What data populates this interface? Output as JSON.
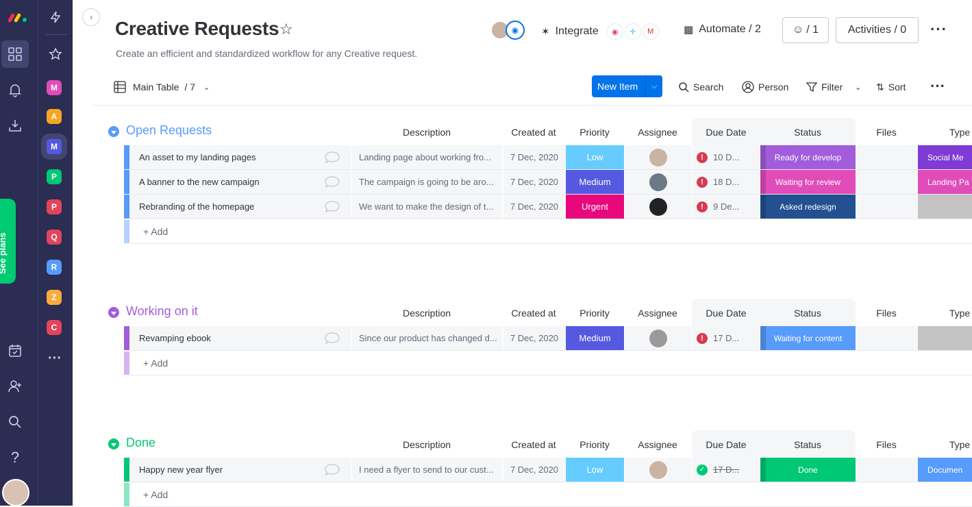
{
  "nav": {
    "logo_colors": [
      "#f62b54",
      "#ffcc00",
      "#00ca72"
    ],
    "see_plans_label": "See plans",
    "workspaces": [
      {
        "letter": "M",
        "color": "#e04cb8"
      },
      {
        "letter": "A",
        "color": "#f5a623"
      },
      {
        "letter": "M",
        "color": "#5559df"
      },
      {
        "letter": "P",
        "color": "#00c875"
      },
      {
        "letter": "P",
        "color": "#e2445c"
      },
      {
        "letter": "Q",
        "color": "#e2445c"
      },
      {
        "letter": "R",
        "color": "#579bfc"
      },
      {
        "letter": "Z",
        "color": "#fdab3d"
      },
      {
        "letter": "C",
        "color": "#e2445c"
      }
    ]
  },
  "header": {
    "title": "Creative Requests",
    "subtitle": "Create an efficient and standardized workflow for any Creative request.",
    "integrate_label": "Integrate",
    "automate_label": "Automate / 2",
    "members_label": "/ 1",
    "activities_label": "Activities / 0"
  },
  "toolbar": {
    "view_label": "Main Table",
    "view_count": "/ 7",
    "new_item_label": "New Item",
    "search_label": "Search",
    "person_label": "Person",
    "filter_label": "Filter",
    "sort_label": "Sort"
  },
  "columns": {
    "description": "Description",
    "created": "Created at",
    "priority": "Priority",
    "assignee": "Assignee",
    "due": "Due Date",
    "status": "Status",
    "files": "Files",
    "type": "Type"
  },
  "colors": {
    "open": "#579bfc",
    "working": "#a25ddc",
    "done": "#00c875",
    "low": "#66ccff",
    "medium": "#5559df",
    "urgent": "#e8087b"
  },
  "groups": [
    {
      "title": "Open Requests",
      "color": "#579bfc",
      "add_label": "+ Add",
      "rows": [
        {
          "name": "An asset to my landing pages",
          "desc": "Landing page about working fro...",
          "created": "7 Dec, 2020",
          "priority": "Low",
          "prio_color": "#66ccff",
          "due": "10 D...",
          "status": "Ready for develop",
          "status_color": "#a25ddc",
          "type": "Social Me",
          "type_color": "#7e3bd6"
        },
        {
          "name": "A banner to the new campaign",
          "desc": "The campaign is going to be aro...",
          "created": "7 Dec, 2020",
          "priority": "Medium",
          "prio_color": "#5559df",
          "due": "18 D...",
          "status": "Waiting for review",
          "status_color": "#e04cb8",
          "type": "Landing Pa",
          "type_color": "#e04cb8"
        },
        {
          "name": "Rebranding of the homepage",
          "desc": "We want to make the design of t...",
          "created": "7 Dec, 2020",
          "priority": "Urgent",
          "prio_color": "#e8087b",
          "due": "9 De...",
          "status": "Asked redesign",
          "status_color": "#225091",
          "type": "",
          "type_color": "#c4c4c4"
        }
      ]
    },
    {
      "title": "Working on it",
      "color": "#a25ddc",
      "add_label": "+ Add",
      "rows": [
        {
          "name": "Revamping ebook",
          "desc": "Since our product has changed d...",
          "created": "7 Dec, 2020",
          "priority": "Medium",
          "prio_color": "#5559df",
          "due": "17 D...",
          "status": "Waiting for content",
          "status_color": "#579bfc",
          "type": "",
          "type_color": "#c4c4c4"
        }
      ]
    },
    {
      "title": "Done",
      "color": "#00c875",
      "add_label": "+ Add",
      "rows": [
        {
          "name": "Happy new year flyer",
          "desc": "I need a flyer to send to our cust...",
          "created": "7 Dec, 2020",
          "priority": "Low",
          "prio_color": "#66ccff",
          "due": "17 D...",
          "status": "Done",
          "status_color": "#00c875",
          "type": "Documen",
          "type_color": "#579bfc"
        }
      ]
    }
  ]
}
